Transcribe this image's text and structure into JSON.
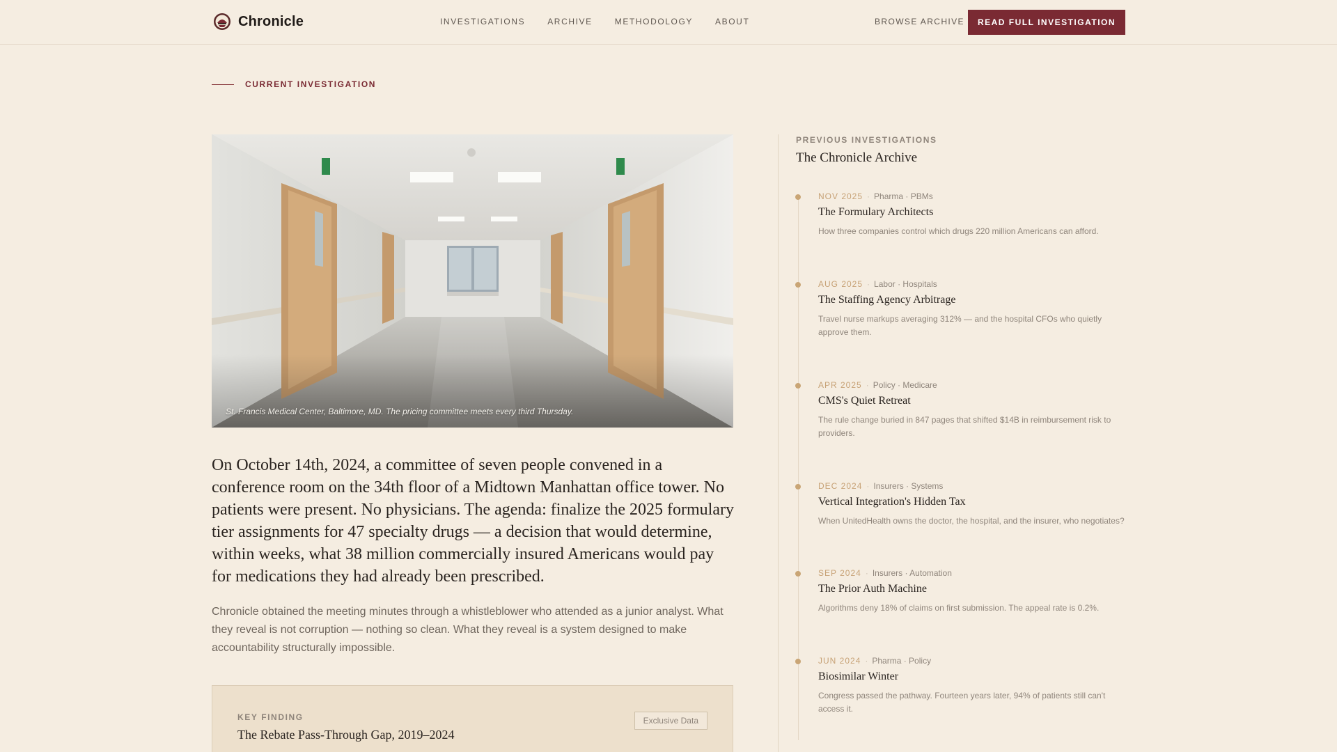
{
  "header": {
    "brand": "Chronicle",
    "nav": [
      "INVESTIGATIONS",
      "ARCHIVE",
      "METHODOLOGY",
      "ABOUT"
    ],
    "browse_link": "BROWSE ARCHIVE",
    "cta": "READ FULL INVESTIGATION"
  },
  "section": {
    "label": "CURRENT INVESTIGATION"
  },
  "hero": {
    "caption": "St. Francis Medical Center, Baltimore, MD. The pricing committee meets every third Thursday."
  },
  "article": {
    "lede": "On October 14th, 2024, a committee of seven people convened in a conference room on the 34th floor of a Midtown Manhattan office tower. No patients were present. No physicians. The agenda: finalize the 2025 formulary tier assignments for 47 specialty drugs — a decision that would determine, within weeks, what 38 million commercially insured Americans would pay for medications they had already been prescribed.",
    "body": "Chronicle obtained the meeting minutes through a whistleblower who attended as a junior analyst. What they reveal is not corruption — nothing so clean. What they reveal is a system designed to make accountability structurally impossible."
  },
  "key_finding": {
    "kicker": "KEY FINDING",
    "title": "The Rebate Pass-Through Gap, 2019–2024",
    "badge": "Exclusive Data"
  },
  "sidebar": {
    "kicker": "PREVIOUS INVESTIGATIONS",
    "title": "The Chronicle Archive",
    "items": [
      {
        "date": "NOV 2025",
        "tags": "Pharma · PBMs",
        "title": "The Formulary Architects",
        "desc": "How three companies control which drugs 220 million Americans can afford."
      },
      {
        "date": "AUG 2025",
        "tags": "Labor · Hospitals",
        "title": "The Staffing Agency Arbitrage",
        "desc": "Travel nurse markups averaging 312% — and the hospital CFOs who quietly approve them."
      },
      {
        "date": "APR 2025",
        "tags": "Policy · Medicare",
        "title": "CMS's Quiet Retreat",
        "desc": "The rule change buried in 847 pages that shifted $14B in reimbursement risk to providers."
      },
      {
        "date": "DEC 2024",
        "tags": "Insurers · Systems",
        "title": "Vertical Integration's Hidden Tax",
        "desc": "When UnitedHealth owns the doctor, the hospital, and the insurer, who negotiates?"
      },
      {
        "date": "SEP 2024",
        "tags": "Insurers · Automation",
        "title": "The Prior Auth Machine",
        "desc": "Algorithms deny 18% of claims on first submission. The appeal rate is 0.2%."
      },
      {
        "date": "JUN 2024",
        "tags": "Pharma · Policy",
        "title": "Biosimilar Winter",
        "desc": "Congress passed the pathway. Fourteen years later, 94% of patients still can't access it."
      }
    ]
  }
}
